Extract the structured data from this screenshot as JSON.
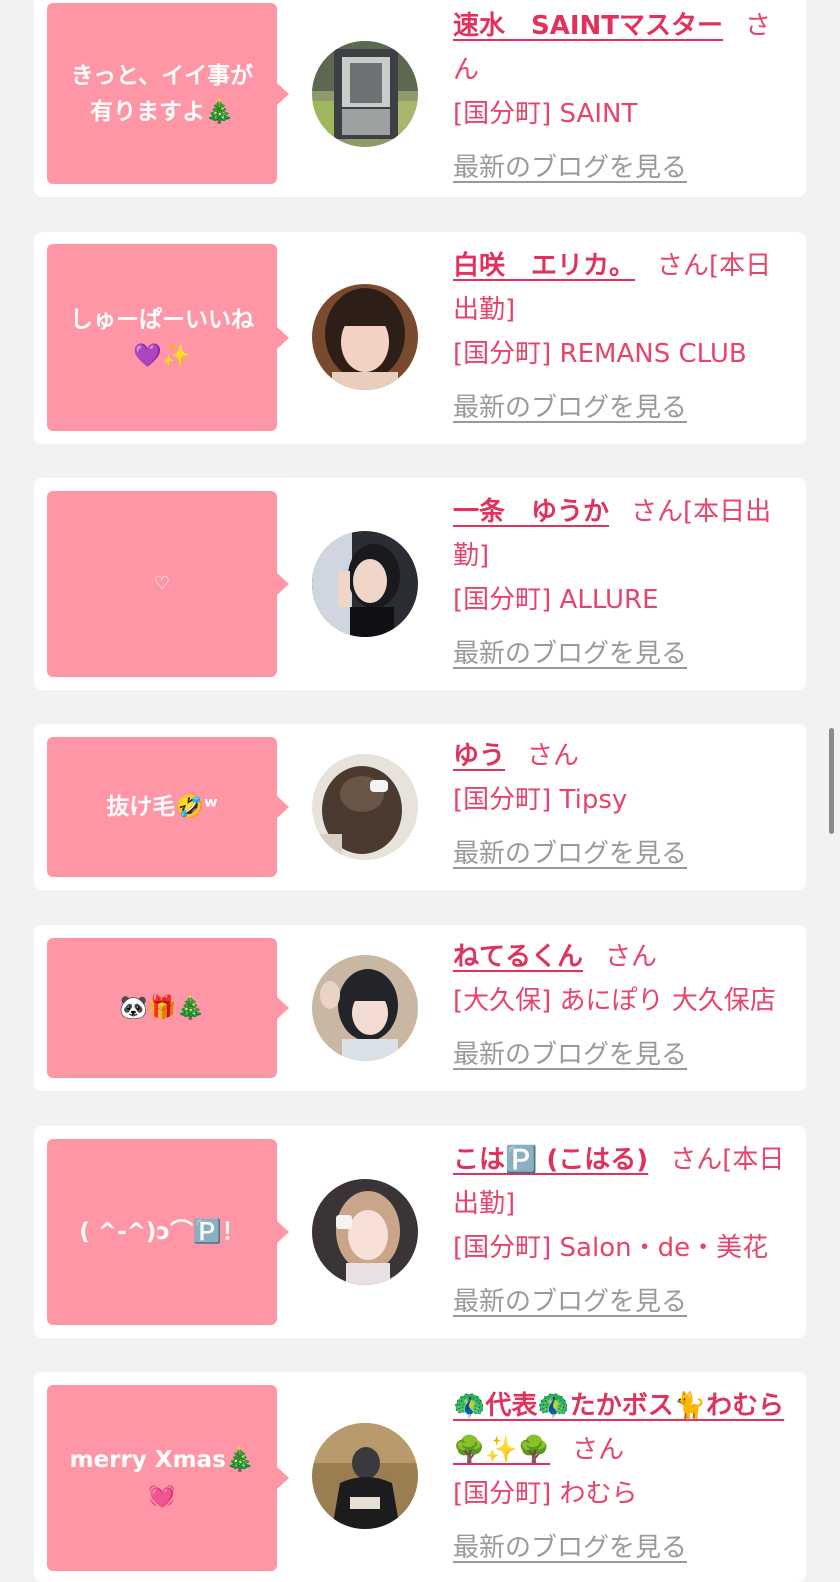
{
  "cards": [
    {
      "bubble": "きっと、イイ事が\n有りますよ🎄",
      "name": "速水　SAINTマスター",
      "honorific": "さん",
      "status": "",
      "shop": "[国分町] SAINT",
      "blog_link": "最新のブログを見る",
      "avatar": "van-interior"
    },
    {
      "bubble": "しゅーぱーいいね\n💜✨",
      "name": "白咲　エリカ。",
      "honorific": "さん",
      "status": "[本日出勤]",
      "shop": "[国分町] REMANS CLUB",
      "blog_link": "最新のブログを見る",
      "avatar": "woman-brown"
    },
    {
      "bubble": "♡",
      "name": "一条　ゆうか",
      "honorific": "さん",
      "status": "[本日出勤]",
      "shop": "[国分町] ALLURE",
      "blog_link": "最新のブログを見る",
      "avatar": "woman-dark"
    },
    {
      "bubble": "抜け毛🤣ʷ",
      "name": "ゆう",
      "honorific": "さん",
      "status": "",
      "shop": "[国分町] Tipsy",
      "blog_link": "最新のブログを見る",
      "avatar": "hair-bun"
    },
    {
      "bubble": "🐼🎁🎄",
      "name": "ねてるくん",
      "honorific": "さん",
      "status": "",
      "shop": "[大久保] あにぽり 大久保店",
      "blog_link": "最新のブログを見る",
      "avatar": "woman-bob"
    },
    {
      "bubble": "( ^-^)ɔ⌒🅿️！",
      "name": "こは🅿️ (こはる)",
      "honorific": "さん",
      "status": "[本日出勤]",
      "shop": "[国分町] Salon・de・美花",
      "blog_link": "最新のブログを見る",
      "avatar": "woman-pink"
    },
    {
      "bubble": "merry Xmas🎄\n💓",
      "name": "🦚代表🦚たかボス🐈わむら🌳✨🌳",
      "honorific": "さん",
      "status": "",
      "shop": "[国分町] わむら",
      "blog_link": "最新のブログを見る",
      "avatar": "boss-jacket"
    }
  ],
  "colors": {
    "bubble": "#ff96a6",
    "link": "#e0325c",
    "text": "#e8436b",
    "blog": "#9a9a9a",
    "background": "#f2f2f2"
  }
}
